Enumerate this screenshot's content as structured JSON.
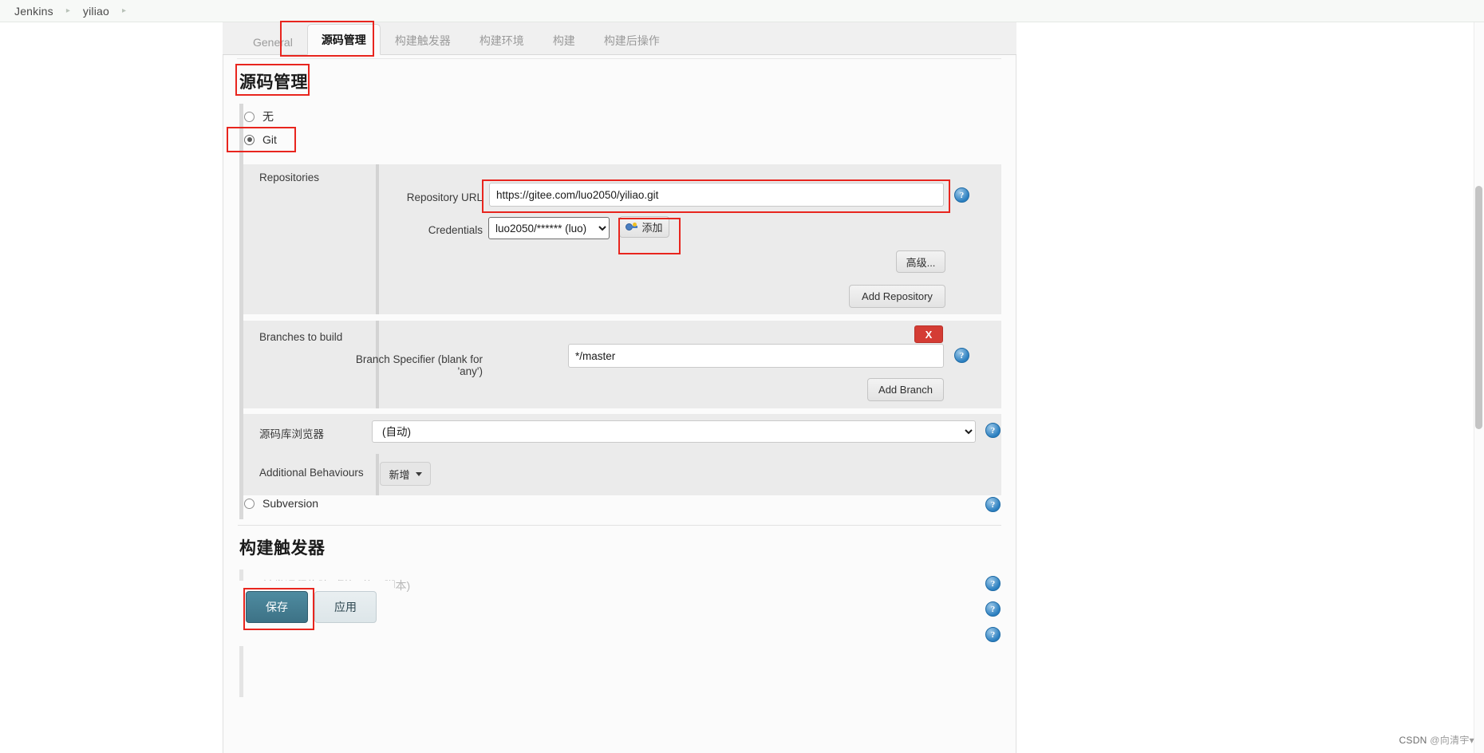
{
  "breadcrumb": {
    "items": [
      "Jenkins",
      "yiliao"
    ],
    "separator": "▸"
  },
  "tabs": [
    {
      "label": "General",
      "active": false
    },
    {
      "label": "源码管理",
      "active": true
    },
    {
      "label": "构建触发器",
      "active": false
    },
    {
      "label": "构建环境",
      "active": false
    },
    {
      "label": "构建",
      "active": false
    },
    {
      "label": "构建后操作",
      "active": false
    }
  ],
  "scm": {
    "heading": "源码管理",
    "options": [
      {
        "label": "无",
        "checked": false
      },
      {
        "label": "Git",
        "checked": true
      },
      {
        "label": "Subversion",
        "checked": false
      }
    ],
    "repositories": {
      "label": "Repositories",
      "repository_url": {
        "label": "Repository URL",
        "value": "https://gitee.com/luo2050/yiliao.git"
      },
      "credentials": {
        "label": "Credentials",
        "value": "luo2050/****** (luo)",
        "add_button": "添加"
      },
      "advanced_button": "高级...",
      "add_repository_button": "Add Repository"
    },
    "branches": {
      "label": "Branches to build",
      "remove_button": "X",
      "branch_specifier": {
        "label": "Branch Specifier (blank for 'any')",
        "value": "*/master"
      },
      "add_branch_button": "Add Branch"
    },
    "repo_browser": {
      "label": "源码库浏览器",
      "value": "(自动)"
    },
    "additional_behaviours": {
      "label": "Additional Behaviours",
      "add_button": "新增"
    }
  },
  "triggers": {
    "heading": "构建触发器",
    "remote_trigger_label": "触发远程构建 (例如,使用脚本)"
  },
  "footer": {
    "save_button": "保存",
    "apply_button": "应用"
  },
  "watermark": {
    "prefix": "CSDN ",
    "user": "@向清宇▾"
  },
  "icons": {
    "help": "?"
  }
}
